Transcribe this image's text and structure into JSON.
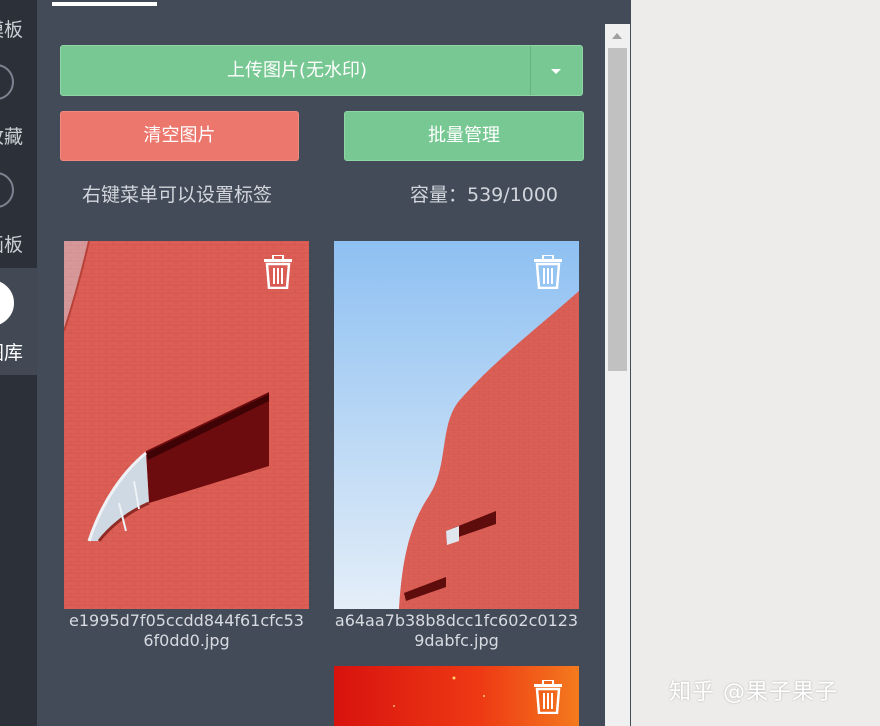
{
  "rail": {
    "items": [
      {
        "label": "模板",
        "active": false
      },
      {
        "label": "收藏",
        "active": false
      },
      {
        "label": "画板",
        "active": false
      },
      {
        "label": "图库",
        "active": true
      }
    ]
  },
  "toolbar": {
    "upload_label": "上传图片(无水印)",
    "clear_label": "清空图片",
    "batch_label": "批量管理"
  },
  "info": {
    "hint": "右键菜单可以设置标签",
    "capacity": "容量：539/1000"
  },
  "gallery": {
    "items": [
      {
        "filename": "e1995d7f05ccdd844f61cfc536f0dd0.jpg"
      },
      {
        "filename": "a64aa7b38b8dcc1fc602c01239dabfc.jpg"
      },
      {
        "filename": ""
      }
    ]
  },
  "watermark": "知乎 @果子果子",
  "colors": {
    "accent_green": "#77c893",
    "accent_red": "#ec776d",
    "panel": "#434b58",
    "rail": "#2c3038"
  }
}
